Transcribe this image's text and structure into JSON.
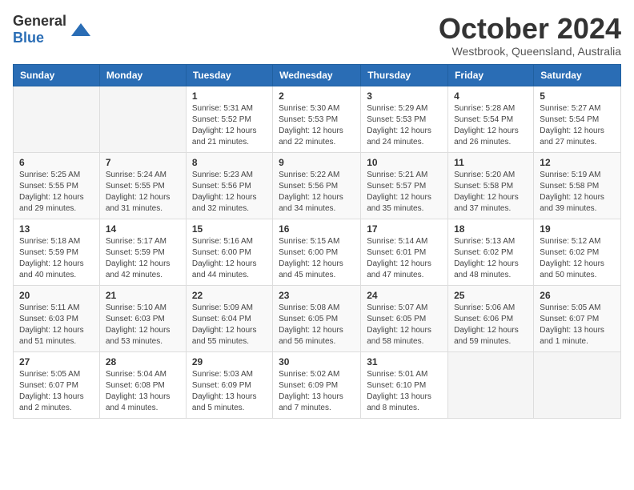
{
  "header": {
    "logo_general": "General",
    "logo_blue": "Blue",
    "month_title": "October 2024",
    "location": "Westbrook, Queensland, Australia"
  },
  "days_of_week": [
    "Sunday",
    "Monday",
    "Tuesday",
    "Wednesday",
    "Thursday",
    "Friday",
    "Saturday"
  ],
  "weeks": [
    [
      {
        "day": "",
        "info": ""
      },
      {
        "day": "",
        "info": ""
      },
      {
        "day": "1",
        "info": "Sunrise: 5:31 AM\nSunset: 5:52 PM\nDaylight: 12 hours\nand 21 minutes."
      },
      {
        "day": "2",
        "info": "Sunrise: 5:30 AM\nSunset: 5:53 PM\nDaylight: 12 hours\nand 22 minutes."
      },
      {
        "day": "3",
        "info": "Sunrise: 5:29 AM\nSunset: 5:53 PM\nDaylight: 12 hours\nand 24 minutes."
      },
      {
        "day": "4",
        "info": "Sunrise: 5:28 AM\nSunset: 5:54 PM\nDaylight: 12 hours\nand 26 minutes."
      },
      {
        "day": "5",
        "info": "Sunrise: 5:27 AM\nSunset: 5:54 PM\nDaylight: 12 hours\nand 27 minutes."
      }
    ],
    [
      {
        "day": "6",
        "info": "Sunrise: 5:25 AM\nSunset: 5:55 PM\nDaylight: 12 hours\nand 29 minutes."
      },
      {
        "day": "7",
        "info": "Sunrise: 5:24 AM\nSunset: 5:55 PM\nDaylight: 12 hours\nand 31 minutes."
      },
      {
        "day": "8",
        "info": "Sunrise: 5:23 AM\nSunset: 5:56 PM\nDaylight: 12 hours\nand 32 minutes."
      },
      {
        "day": "9",
        "info": "Sunrise: 5:22 AM\nSunset: 5:56 PM\nDaylight: 12 hours\nand 34 minutes."
      },
      {
        "day": "10",
        "info": "Sunrise: 5:21 AM\nSunset: 5:57 PM\nDaylight: 12 hours\nand 35 minutes."
      },
      {
        "day": "11",
        "info": "Sunrise: 5:20 AM\nSunset: 5:58 PM\nDaylight: 12 hours\nand 37 minutes."
      },
      {
        "day": "12",
        "info": "Sunrise: 5:19 AM\nSunset: 5:58 PM\nDaylight: 12 hours\nand 39 minutes."
      }
    ],
    [
      {
        "day": "13",
        "info": "Sunrise: 5:18 AM\nSunset: 5:59 PM\nDaylight: 12 hours\nand 40 minutes."
      },
      {
        "day": "14",
        "info": "Sunrise: 5:17 AM\nSunset: 5:59 PM\nDaylight: 12 hours\nand 42 minutes."
      },
      {
        "day": "15",
        "info": "Sunrise: 5:16 AM\nSunset: 6:00 PM\nDaylight: 12 hours\nand 44 minutes."
      },
      {
        "day": "16",
        "info": "Sunrise: 5:15 AM\nSunset: 6:00 PM\nDaylight: 12 hours\nand 45 minutes."
      },
      {
        "day": "17",
        "info": "Sunrise: 5:14 AM\nSunset: 6:01 PM\nDaylight: 12 hours\nand 47 minutes."
      },
      {
        "day": "18",
        "info": "Sunrise: 5:13 AM\nSunset: 6:02 PM\nDaylight: 12 hours\nand 48 minutes."
      },
      {
        "day": "19",
        "info": "Sunrise: 5:12 AM\nSunset: 6:02 PM\nDaylight: 12 hours\nand 50 minutes."
      }
    ],
    [
      {
        "day": "20",
        "info": "Sunrise: 5:11 AM\nSunset: 6:03 PM\nDaylight: 12 hours\nand 51 minutes."
      },
      {
        "day": "21",
        "info": "Sunrise: 5:10 AM\nSunset: 6:03 PM\nDaylight: 12 hours\nand 53 minutes."
      },
      {
        "day": "22",
        "info": "Sunrise: 5:09 AM\nSunset: 6:04 PM\nDaylight: 12 hours\nand 55 minutes."
      },
      {
        "day": "23",
        "info": "Sunrise: 5:08 AM\nSunset: 6:05 PM\nDaylight: 12 hours\nand 56 minutes."
      },
      {
        "day": "24",
        "info": "Sunrise: 5:07 AM\nSunset: 6:05 PM\nDaylight: 12 hours\nand 58 minutes."
      },
      {
        "day": "25",
        "info": "Sunrise: 5:06 AM\nSunset: 6:06 PM\nDaylight: 12 hours\nand 59 minutes."
      },
      {
        "day": "26",
        "info": "Sunrise: 5:05 AM\nSunset: 6:07 PM\nDaylight: 13 hours\nand 1 minute."
      }
    ],
    [
      {
        "day": "27",
        "info": "Sunrise: 5:05 AM\nSunset: 6:07 PM\nDaylight: 13 hours\nand 2 minutes."
      },
      {
        "day": "28",
        "info": "Sunrise: 5:04 AM\nSunset: 6:08 PM\nDaylight: 13 hours\nand 4 minutes."
      },
      {
        "day": "29",
        "info": "Sunrise: 5:03 AM\nSunset: 6:09 PM\nDaylight: 13 hours\nand 5 minutes."
      },
      {
        "day": "30",
        "info": "Sunrise: 5:02 AM\nSunset: 6:09 PM\nDaylight: 13 hours\nand 7 minutes."
      },
      {
        "day": "31",
        "info": "Sunrise: 5:01 AM\nSunset: 6:10 PM\nDaylight: 13 hours\nand 8 minutes."
      },
      {
        "day": "",
        "info": ""
      },
      {
        "day": "",
        "info": ""
      }
    ]
  ]
}
